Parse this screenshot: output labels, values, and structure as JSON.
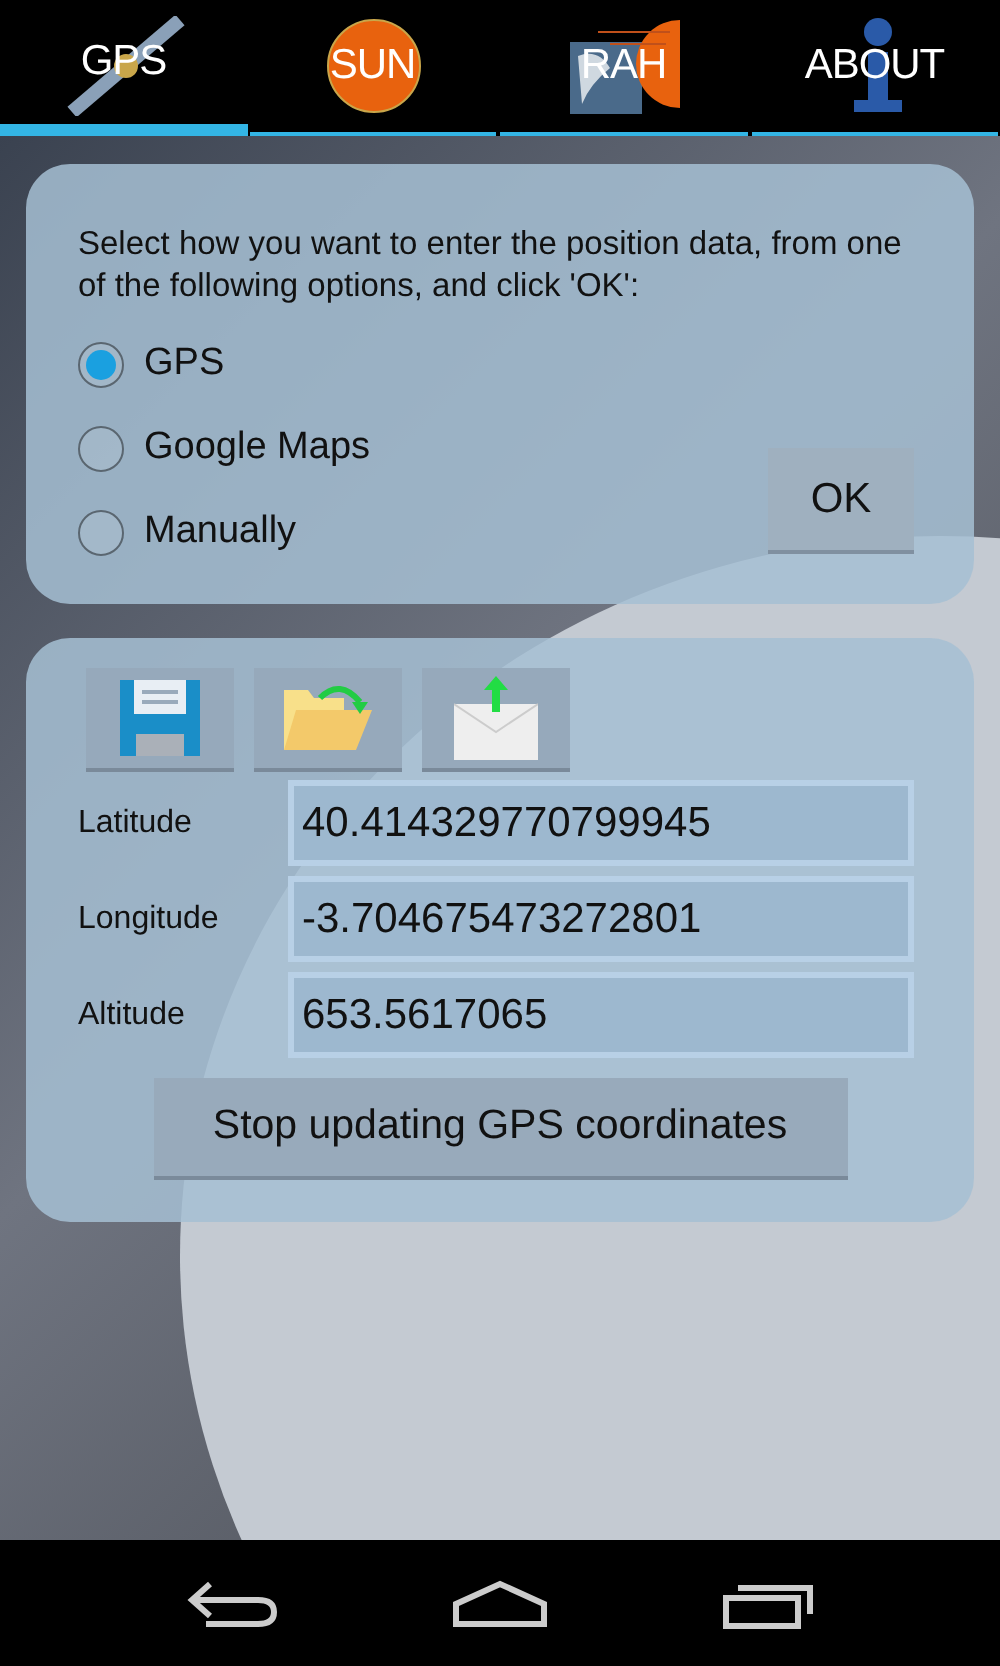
{
  "tabs": [
    {
      "label": "GPS",
      "kind": "satellite",
      "selected": true
    },
    {
      "label": "SUN",
      "kind": "sun",
      "selected": false
    },
    {
      "label": "RAH",
      "kind": "earth",
      "selected": false
    },
    {
      "label": "ABOUT",
      "kind": "info",
      "selected": false
    }
  ],
  "input_panel": {
    "instructions": "Select how you want to enter the position data, from one of the following options, and click 'OK':",
    "options": [
      {
        "label": "GPS",
        "selected": true
      },
      {
        "label": "Google Maps",
        "selected": false
      },
      {
        "label": "Manually",
        "selected": false
      }
    ],
    "ok_button": "OK"
  },
  "position_panel": {
    "toolbar": [
      {
        "kind": "save"
      },
      {
        "kind": "open"
      },
      {
        "kind": "send"
      }
    ],
    "fields": [
      {
        "label": "Latitude",
        "value": "40.414329770799945"
      },
      {
        "label": "Longitude",
        "value": "-3.704675473272801"
      },
      {
        "label": "Altitude",
        "value": "653.5617065"
      }
    ],
    "stop_button": "Stop updating GPS coordinates"
  }
}
